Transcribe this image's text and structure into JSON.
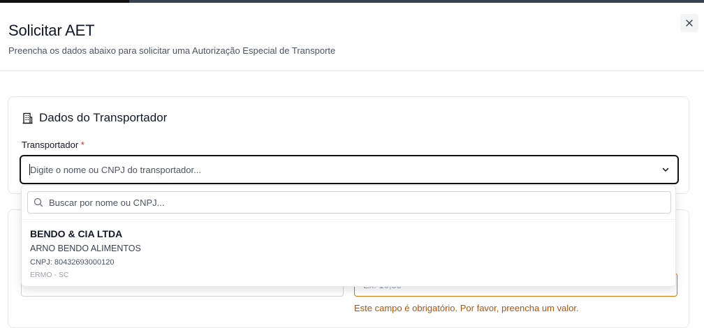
{
  "page": {
    "progress": 0.184
  },
  "dialog": {
    "title": "Solicitar AET",
    "subtitle": "Preencha os dados abaixo para solicitar uma Autorização Especial de Transporte",
    "close_icon": "close-icon"
  },
  "section_transportador": {
    "icon": "building-icon",
    "title": "Dados do Transportador",
    "field_label": "Transportador",
    "required_mark": "*",
    "combo_placeholder": "Digite o nome ou CNPJ do transportador...",
    "chevron_icon": "chevron-down-icon"
  },
  "dropdown": {
    "search_icon": "search-icon",
    "search_placeholder": "Buscar por nome ou CNPJ...",
    "results": [
      {
        "name": "BENDO & CIA LTDA",
        "trade_name": "ARNO BENDO ALIMENTOS",
        "cnpj": "CNPJ: 80432693000120",
        "location": "ERMO - SC"
      }
    ]
  },
  "section_2": {
    "right_input_value": "Ex: 10,50",
    "error_message": "Este campo é obrigatório. Por favor, preencha um valor."
  },
  "colors": {
    "accent": "#111111",
    "error": "#b45309",
    "required": "#dc2626"
  }
}
